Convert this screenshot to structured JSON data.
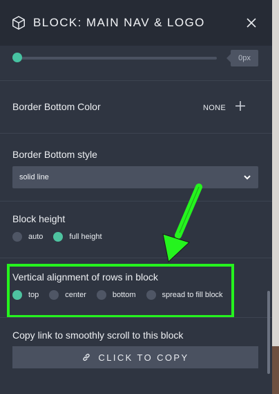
{
  "header": {
    "title": "BLOCK: MAIN NAV & LOGO"
  },
  "slider": {
    "value_label": "0px"
  },
  "border_bottom_color": {
    "label": "Border Bottom Color",
    "value": "NONE"
  },
  "border_bottom_style": {
    "label": "Border Bottom style",
    "selected": "solid line"
  },
  "block_height": {
    "label": "Block height",
    "options": [
      {
        "label": "auto",
        "selected": false
      },
      {
        "label": "full height",
        "selected": true
      }
    ]
  },
  "vertical_alignment": {
    "label": "Vertical alignment of rows in block",
    "options": [
      {
        "label": "top",
        "selected": true
      },
      {
        "label": "center",
        "selected": false
      },
      {
        "label": "bottom",
        "selected": false
      },
      {
        "label": "spread to fill block",
        "selected": false
      }
    ]
  },
  "copy_link": {
    "label": "Copy link to smoothly scroll to this block",
    "button_label": "CLICK TO COPY"
  },
  "colors": {
    "panel_bg": "#2f3541",
    "accent": "#4ec3a0",
    "highlight": "#25f41e"
  },
  "icons": [
    "cube-icon",
    "close-icon",
    "plus-icon",
    "chevron-down-icon",
    "link-icon",
    "arrow-annotation"
  ]
}
